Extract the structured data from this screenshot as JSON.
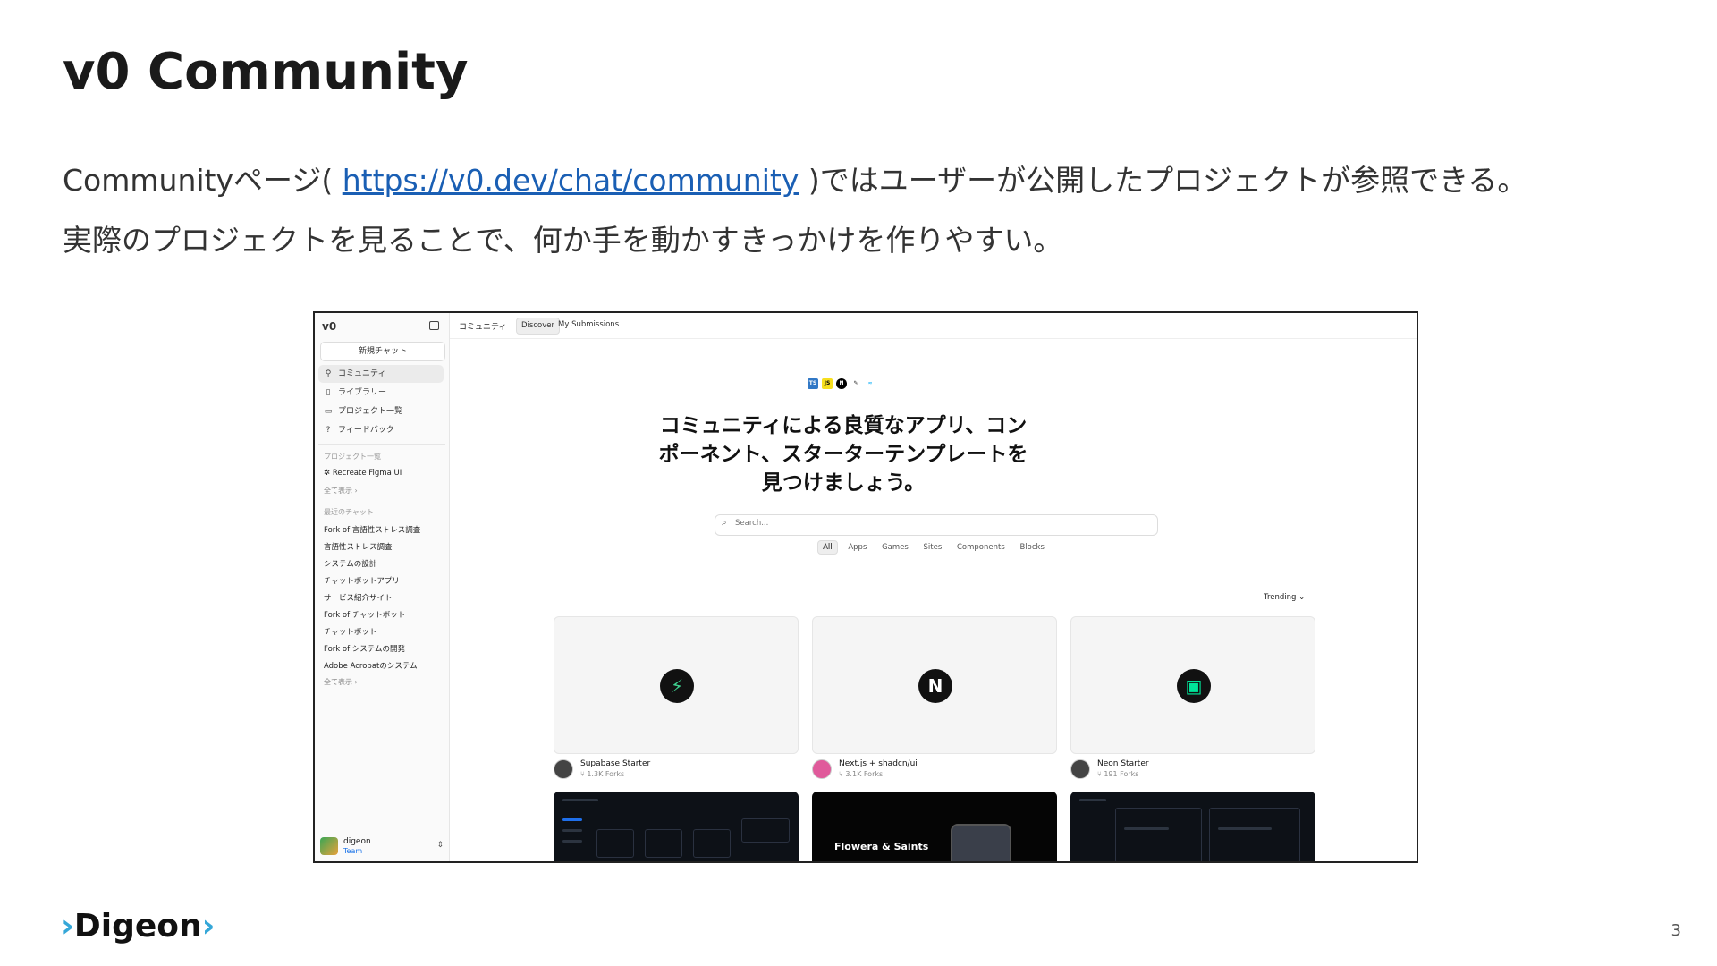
{
  "slide": {
    "title": "v0 Community",
    "desc1_pre": "Communityページ(",
    "desc1_link": "https://v0.dev/chat/community",
    "desc1_post": ")ではユーザーが公開したプロジェクトが参照できる。",
    "desc2": "実際のプロジェクトを見ることで、何か手を動かすきっかけを作りやすい。",
    "brand": "Digeon",
    "page_number": "3"
  },
  "app": {
    "logo": "v0",
    "new_chat": "新規チャット",
    "nav": [
      {
        "label": "コミュニティ",
        "icon": "community-icon"
      },
      {
        "label": "ライブラリー",
        "icon": "library-icon"
      },
      {
        "label": "プロジェクト一覧",
        "icon": "folder-icon"
      },
      {
        "label": "フィードバック",
        "icon": "help-icon"
      }
    ],
    "projects_heading": "プロジェクト一覧",
    "project_item": "Recreate Figma UI",
    "show_all": "全て表示 ›",
    "recent_heading": "最近のチャット",
    "recent_chats": [
      "Fork of 言語性ストレス調査",
      "言語性ストレス調査",
      "システムの設計",
      "チャットボットアプリ",
      "サービス紹介サイト",
      "Fork of チャットボット",
      "チャットボット",
      "Fork of システムの開発",
      "Adobe Acrobatのシステム"
    ],
    "show_all_2": "全て表示 ›",
    "user_name": "digeon",
    "user_team": "Team",
    "topbar_label": "コミュニティ",
    "tabs": [
      "Discover",
      "My Submissions"
    ],
    "hero_line1": "コミュニティによる良質なアプリ、コン",
    "hero_line2": "ポーネント、スターターテンプレートを",
    "hero_line3": "見つけましょう。",
    "search_placeholder": "Search...",
    "filters": [
      "All",
      "Apps",
      "Games",
      "Sites",
      "Components",
      "Blocks"
    ],
    "sort": "Trending",
    "cards": [
      {
        "title": "Supabase Starter",
        "forks": "1.3K Forks"
      },
      {
        "title": "Next.js + shadcn/ui",
        "forks": "3.1K Forks"
      },
      {
        "title": "Neon Starter",
        "forks": "191 Forks"
      }
    ],
    "dark_card_title": "Flowera & Saints"
  }
}
